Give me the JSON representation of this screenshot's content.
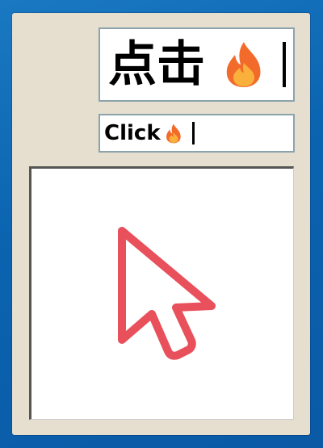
{
  "large_field": {
    "text": "点击",
    "icon": "fire-emoji-icon"
  },
  "small_field": {
    "text": "Click",
    "icon": "fire-emoji-icon"
  },
  "canvas": {
    "icon": "mouse-pointer-icon",
    "icon_color": "#e8505b"
  },
  "colors": {
    "desktop": "#0b63b0",
    "panel": "#e6dfcf",
    "field_border": "#8ca3ac",
    "flame_outer": "#f26b2a",
    "flame_inner": "#fbb03b"
  }
}
